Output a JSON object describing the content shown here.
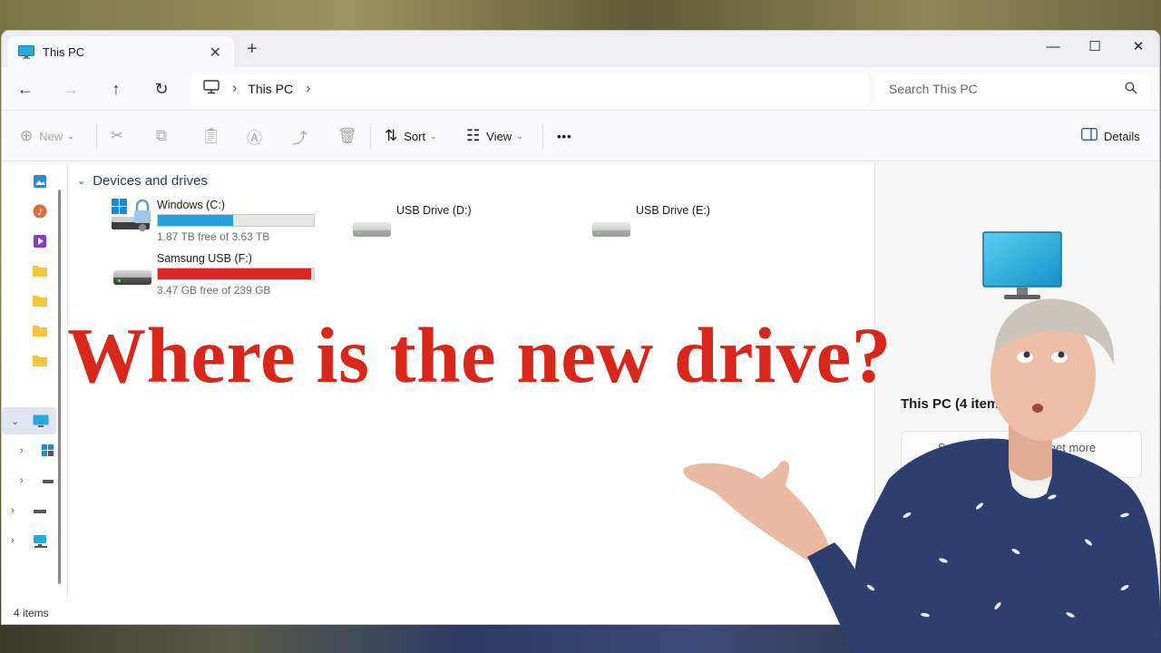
{
  "window": {
    "tab_title": "This PC",
    "tab_close": "✕",
    "new_tab": "+",
    "controls": {
      "minimize": "—",
      "maximize": "☐",
      "close": "✕"
    }
  },
  "nav": {
    "back": "←",
    "forward": "→",
    "up": "↑",
    "refresh": "↻",
    "breadcrumb": [
      "This PC"
    ],
    "separator": "›",
    "search_placeholder": "Search This PC"
  },
  "commandbar": {
    "new_label": "New",
    "sort_label": "Sort",
    "view_label": "View",
    "more_label": "•••",
    "details_label": "Details"
  },
  "content": {
    "group_title": "Devices and drives",
    "drives": [
      {
        "name": "Windows (C:)",
        "free_text": "1.87 TB free of 3.63 TB",
        "used_fraction": 0.485,
        "bar_color": "#26a0da"
      },
      {
        "name": "USB Drive (D:)"
      },
      {
        "name": "USB Drive (E:)"
      },
      {
        "name": "Samsung USB (F:)",
        "free_text": "3.47 GB free of 239 GB",
        "used_fraction": 0.985,
        "bar_color": "#da2626"
      }
    ]
  },
  "details_pane": {
    "title": "This PC (4 items)",
    "card_text": "Select a single file to get more information"
  },
  "status": {
    "item_count": "4 items"
  },
  "overlay": {
    "headline": "Where is the new drive?"
  }
}
